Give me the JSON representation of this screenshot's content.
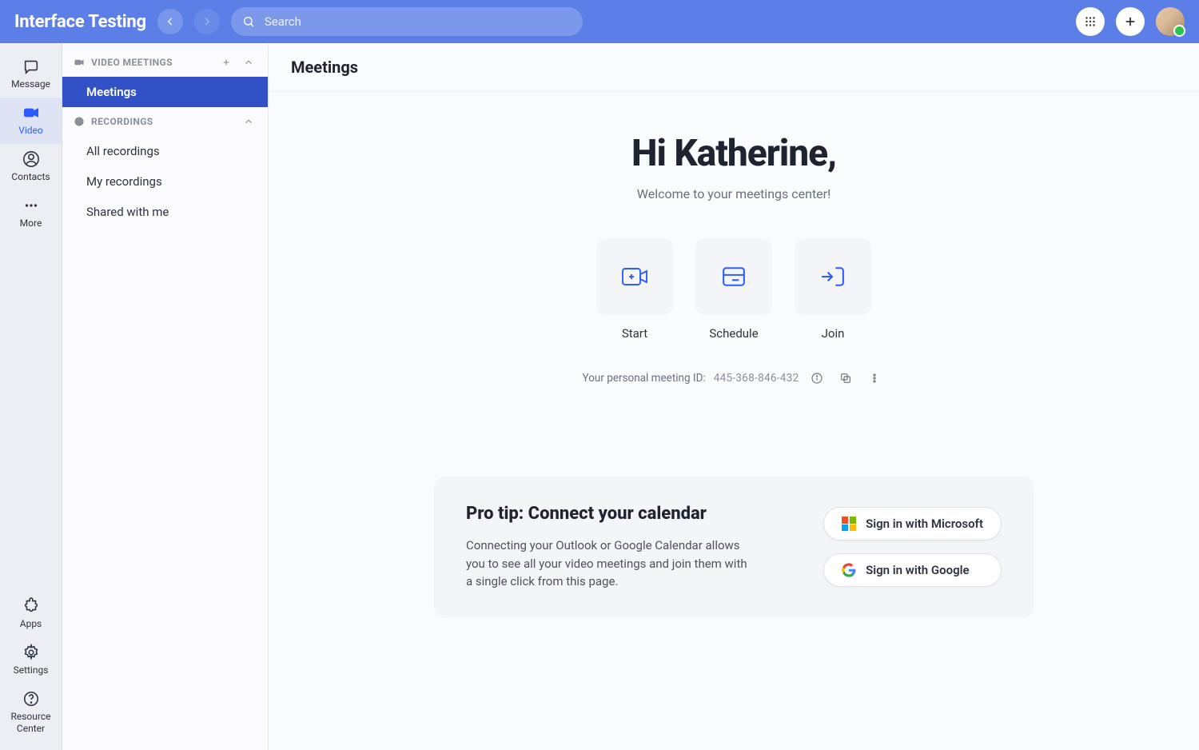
{
  "header": {
    "app_title": "Interface Testing",
    "search_placeholder": "Search"
  },
  "rail": {
    "message": "Message",
    "video": "Video",
    "contacts": "Contacts",
    "more": "More",
    "apps": "Apps",
    "settings": "Settings",
    "resource_center": "Resource Center"
  },
  "subnav": {
    "video_meetings_header": "VIDEO MEETINGS",
    "meetings": "Meetings",
    "recordings_header": "RECORDINGS",
    "all_recordings": "All recordings",
    "my_recordings": "My recordings",
    "shared_with_me": "Shared with me"
  },
  "page": {
    "title": "Meetings",
    "greeting": "Hi Katherine,",
    "welcome": "Welcome to your meetings center!",
    "actions": {
      "start": "Start",
      "schedule": "Schedule",
      "join": "Join"
    },
    "pmi_label": "Your personal meeting ID:",
    "pmi_value": "445-368-846-432"
  },
  "tip": {
    "title": "Pro tip: Connect your calendar",
    "body": "Connecting your Outlook or Google Calendar allows you to see all your video meetings and join them with a single click from this page.",
    "ms_label": "Sign in with Microsoft",
    "google_label": "Sign in with Google"
  }
}
